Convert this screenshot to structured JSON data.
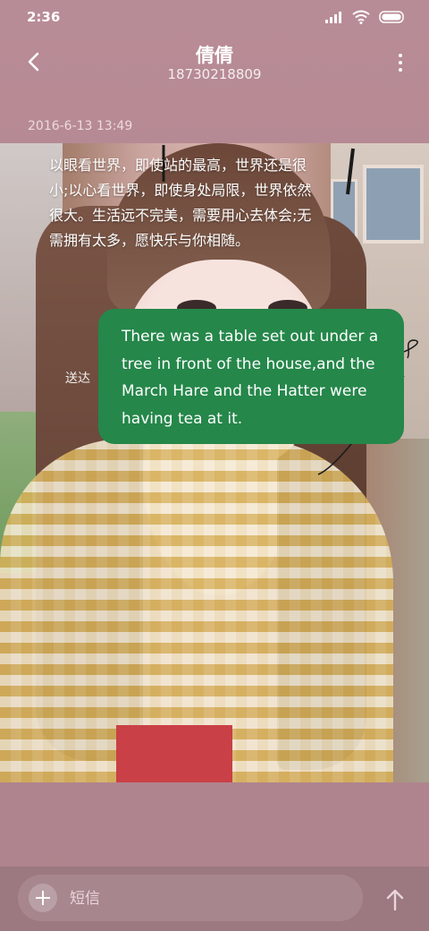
{
  "status_bar": {
    "time": "2:36",
    "icons": [
      "signal-icon",
      "wifi-icon",
      "battery-icon"
    ]
  },
  "header": {
    "title": "倩倩",
    "subtitle": "18730218809",
    "back_icon": "back-icon",
    "more_icon": "more-icon"
  },
  "conversation": {
    "timestamp": "2016-6-13 13:49",
    "received_message": "以眼看世界，即使站的最高，世界还是很小;以心看世界，即使身处局限，世界依然很大。生活远不完美，需要用心去体会;无需拥有太多，愿快乐与你相随。",
    "sent_status": "送达",
    "sent_message": "There was a table set out under a tree in front of the house,and the March Hare and the Hatter were having tea at it."
  },
  "composer": {
    "placeholder": "短信",
    "add_icon": "plus-icon",
    "send_icon": "send-arrow-icon"
  },
  "colors": {
    "bubble_sent": "#25874a",
    "header_bg": "#b88c96"
  }
}
